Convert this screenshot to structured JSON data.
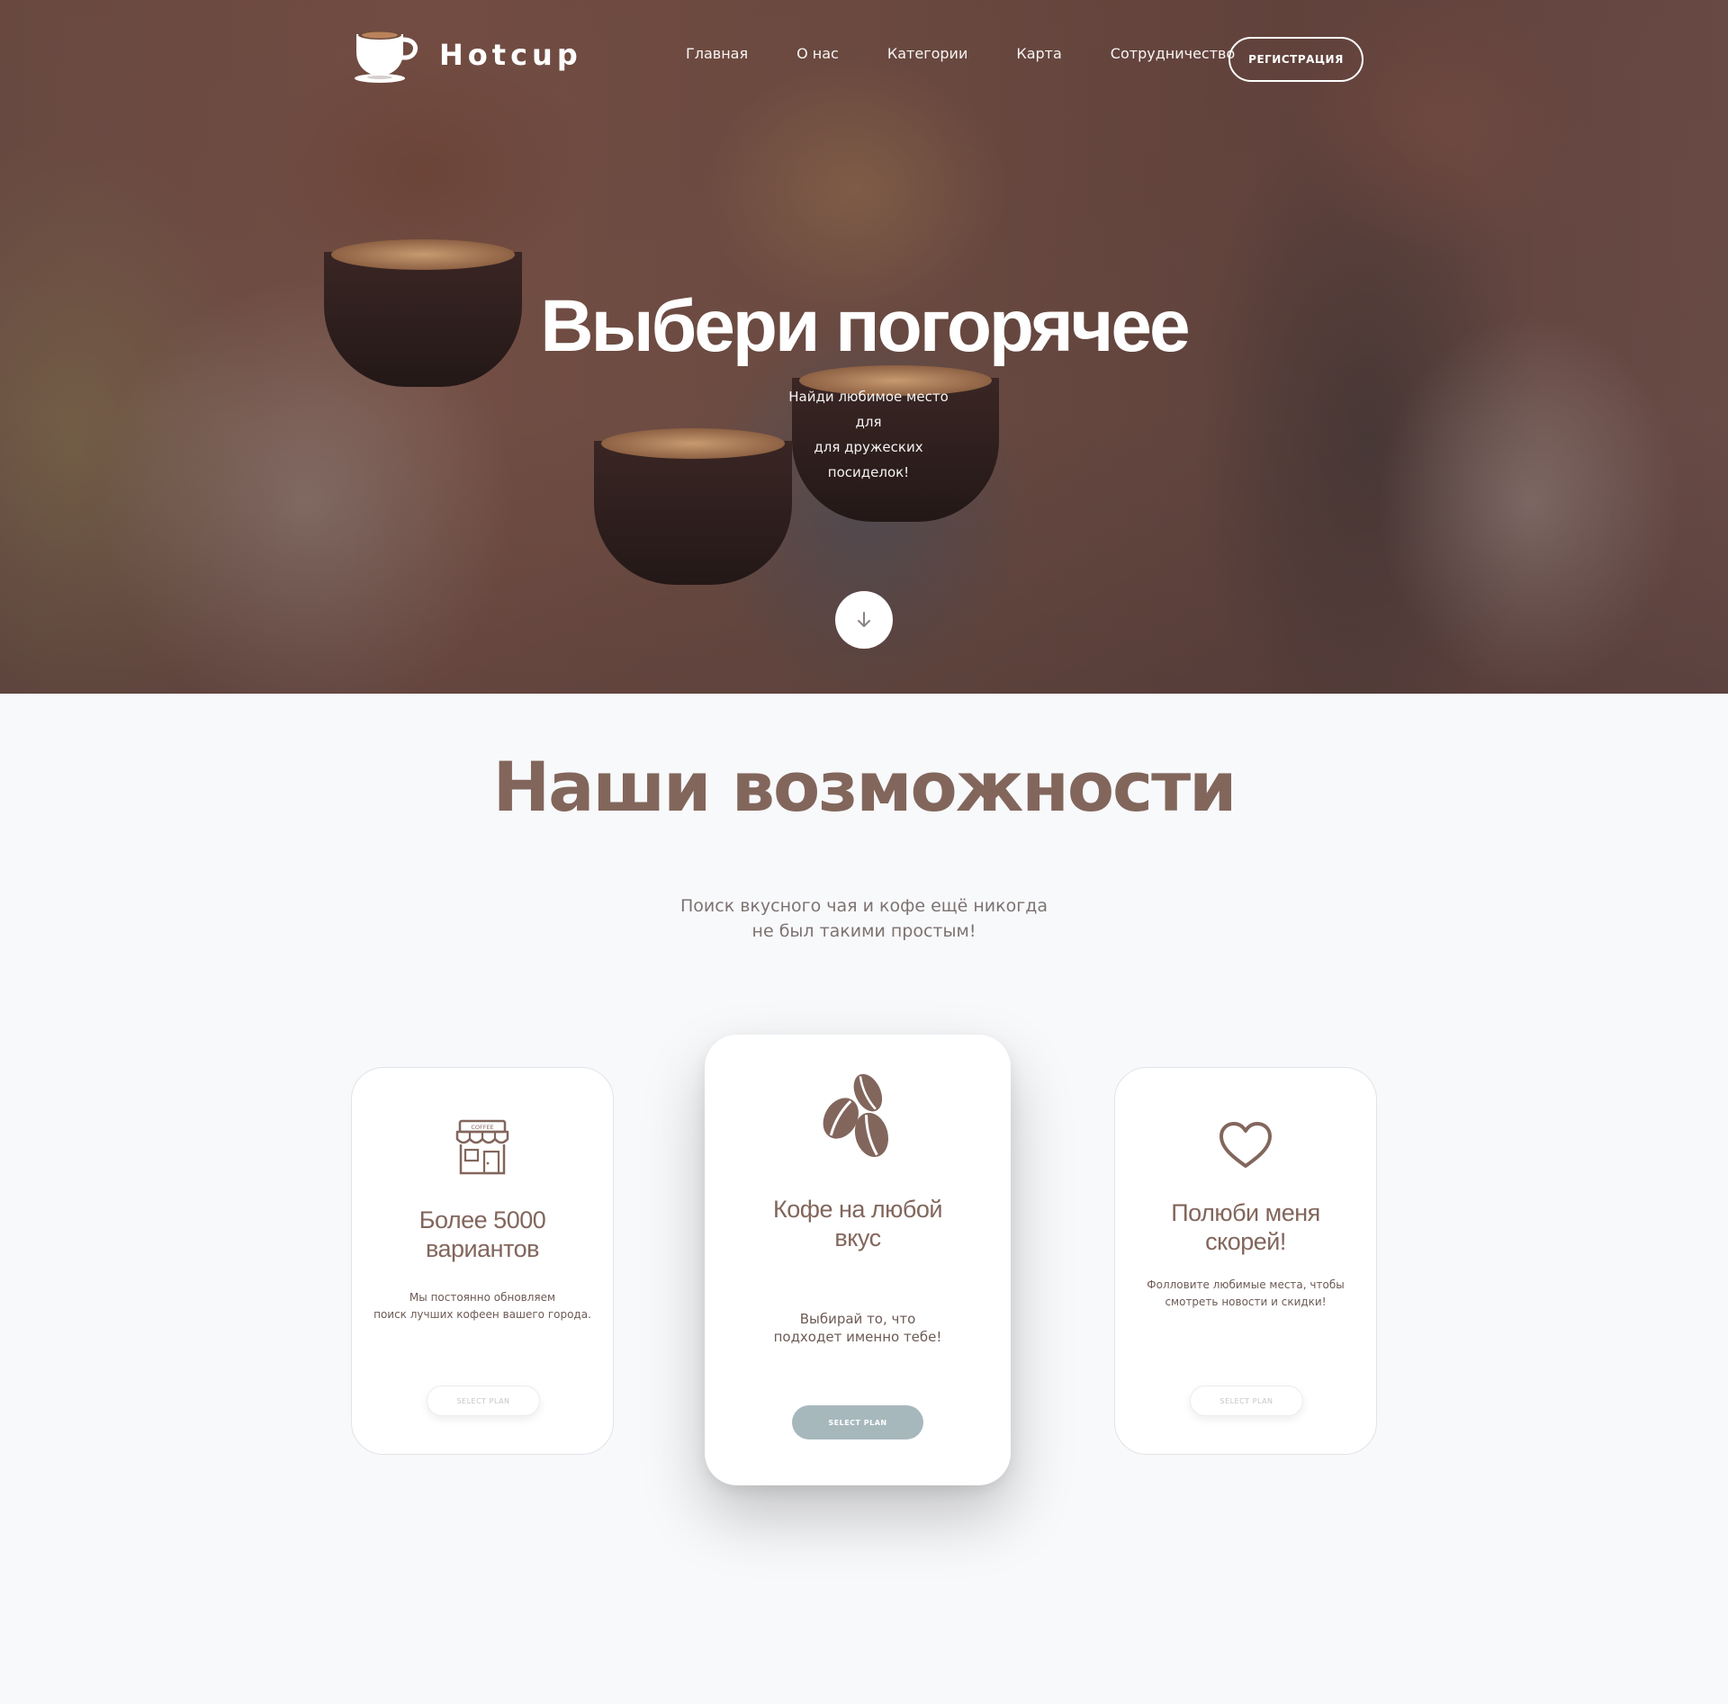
{
  "nav": {
    "brand": "Hotcup",
    "menu": [
      "Главная",
      "О нас",
      "Категории",
      "Карта",
      "Сотрудничество"
    ],
    "register_label": "РЕГИСТРАЦИЯ"
  },
  "hero": {
    "title": "Выбери погорячее",
    "subtitle_lines": [
      "Найди любимое место для",
      "для дружеских посиделок!"
    ]
  },
  "features": {
    "title": "Наши возможности",
    "subtitle_lines": [
      "Поиск вкусного чая и кофе ещё никогда",
      "не был такими простым!"
    ],
    "cards": [
      {
        "icon": "coffee-shop-icon",
        "icon_sign": "COFFEE",
        "title_lines": [
          "Более 5000",
          "вариантов"
        ],
        "text_lines": [
          "Мы постоянно обновляем",
          "поиск лучших кофеен вашего города."
        ],
        "button": "SELECT PLAN"
      },
      {
        "icon": "coffee-beans-icon",
        "title_lines": [
          "Кофе на любой",
          "вкус"
        ],
        "text_lines": [
          "Выбирай то, что",
          "подходет именно тебе!"
        ],
        "button": "SELECT PLAN"
      },
      {
        "icon": "heart-icon",
        "title_lines": [
          "Полюби меня",
          "скорей!"
        ],
        "text_lines": [
          "Фолловите любимые места, чтобы",
          "смотреть новости и скидки!"
        ],
        "button": "SELECT PLAN"
      }
    ]
  },
  "colors": {
    "brand_brown": "#82665c",
    "button_blue_grey": "#a7b8bd",
    "page_background": "#f8f9fb"
  }
}
